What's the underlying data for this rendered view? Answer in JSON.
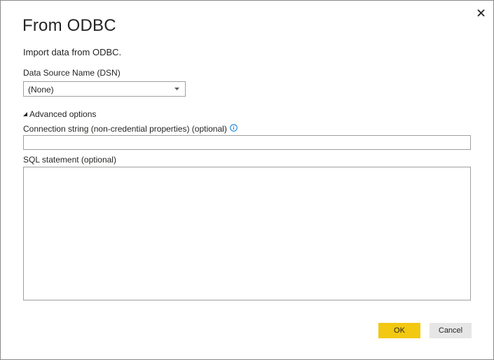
{
  "dialog": {
    "title": "From ODBC",
    "subtitle": "Import data from ODBC.",
    "close_icon": "close-icon"
  },
  "dsn": {
    "label": "Data Source Name (DSN)",
    "selected": "(None)"
  },
  "advanced": {
    "toggle_label": "Advanced options",
    "expanded": true,
    "connection_string": {
      "label": "Connection string (non-credential properties) (optional)",
      "value": "",
      "info_icon": "info-icon"
    },
    "sql_statement": {
      "label": "SQL statement (optional)",
      "value": ""
    }
  },
  "buttons": {
    "ok_label": "OK",
    "cancel_label": "Cancel"
  },
  "colors": {
    "accent": "#f2c811",
    "cancel_bg": "#e6e6e6",
    "border": "#a19f9d",
    "info": "#0078d4"
  }
}
